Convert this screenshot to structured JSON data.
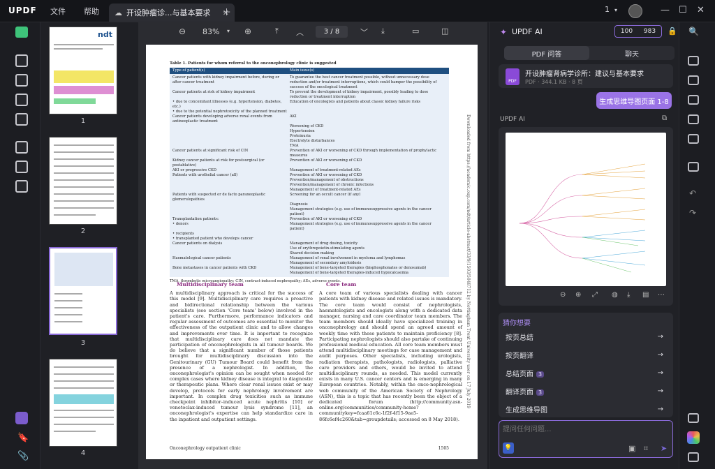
{
  "app": {
    "logo": "UPDF",
    "menu": [
      "文件",
      "帮助"
    ],
    "tab_title": "开设肿瘤诊...与基本要求",
    "page_count_badge": "1"
  },
  "toolbar": {
    "zoom": "83%",
    "page_indicator": "3 / 8"
  },
  "thumbnails": [
    {
      "label": "1"
    },
    {
      "label": "2"
    },
    {
      "label": "3"
    },
    {
      "label": "4"
    }
  ],
  "document": {
    "table_caption": "Table 1. Patients for whom referral to the onconephrology clinic is suggested",
    "col_headers": [
      "Type of patient(s)",
      "Main issue(s)"
    ],
    "rows": [
      [
        "Cancer patients with kidney impairment before, during or after cancer treatment",
        "To guarantee the best cancer treatment possible, without unnecessary dose reduction and/or treatment interruptions, which could hamper the possibility of success of the oncological treatment"
      ],
      [
        "Cancer patients at risk of kidney impairment",
        "To prevent the development of kidney impairment, possibly leading to dose reduction or treatment interruption"
      ],
      [
        "• due to concomitant illnesses (e.g. hypertension, diabetes, etc.)",
        "Education of oncologists and patients about classic kidney failure risks"
      ],
      [
        "• due to the potential nephrotoxicity of the planned treatment",
        ""
      ],
      [
        "Cancer patients developing adverse renal events from antineoplastic treatment",
        "AKI"
      ],
      [
        "",
        "Worsening of CKD"
      ],
      [
        "",
        "Hypertension"
      ],
      [
        "",
        "Proteinuria"
      ],
      [
        "",
        "Electrolyte disturbances"
      ],
      [
        "",
        "TMA"
      ],
      [
        "Cancer patients at significant risk of CIN",
        "Prevention of AKI or worsening of CKD through implementation of prophylactic measures"
      ],
      [
        "Kidney cancer patients at risk for postsurgical (or postablative)",
        "Prevention of AKI or worsening of CKD"
      ],
      [
        "AKI or progressive CKD",
        "Management of treatment-related AEs"
      ],
      [
        "Patients with urothelial cancer (all)",
        "Prevention of AKI or worsening of CKD"
      ],
      [
        "",
        "Prevention/management of obstructions"
      ],
      [
        "",
        "Prevention/management of chronic infections"
      ],
      [
        "",
        "Management of treatment-related AEs"
      ],
      [
        "Patients with suspected or de facto paraneoplastic glomerulopathies",
        "Screening for an occult cancer (if any)"
      ],
      [
        "",
        "Diagnosis"
      ],
      [
        "",
        "Management strategies (e.g. use of immunosuppressive agents in the cancer patient)"
      ],
      [
        "Transplantation patients:",
        "Prevention of AKI or worsening of CKD"
      ],
      [
        "• donors",
        "Management strategies (e.g. use of immunosuppressive agents in the cancer patient)"
      ],
      [
        "• recipients",
        ""
      ],
      [
        "• transplanted patient who develops cancer",
        ""
      ],
      [
        "Cancer patients on dialysis",
        "Management of drug dosing, toxicity"
      ],
      [
        "",
        "Use of erythropoietin-stimulating agents"
      ],
      [
        "",
        "Shared decision making"
      ],
      [
        "Haematological cancer patients",
        "Management of renal involvement in myeloma and lymphomas"
      ],
      [
        "",
        "Management of secondary amyloidosis"
      ],
      [
        "Bone metastases in cancer patients with CKD",
        "Management of bone-targeted therapies (bisphosphonates or denosumab)"
      ],
      [
        "",
        "Management of bone-targeted therapies-induced hypocalcaemia"
      ]
    ],
    "table_note": "TMA, thrombotic microangiopathy; CIN, contrast-induced nephropathy; AEs, adverse events.",
    "left_heading": "Multidisciplinary team",
    "left_body": "A multidisciplinary approach is critical for the success of this model [9]. Multidisciplinary care requires a proactive and bidirectional relationship between the various specialists (see section 'Core team' below) involved in the patient's care. Furthermore, performance indicators and regular assessment of outcomes are essential to monitor the effectiveness of the outpatient clinic and to allow changes and improvements over time. It is important to recognize that multidisciplinary care does not mandate the participation of onconephrologists in all tumour boards. We do believe that a significant number of those patients brought for multidisciplinary discussion into the Genitourinary (GU) Tumour Board could benefit from the presence of a nephrologist. In addition, the onconephrologist's opinion can be sought when needed for complex cases where kidney disease is integral to diagnostic or therapeutic plans. Where clear renal issues exist or may develop, protocols for early nephrology involvement are important. In complex drug toxicities such as immune checkpoint inhibitor–induced acute nephritis [10] or venetoclax-induced tumour lysis syndrome [11], an onconephrologist's expertise can help standardize care in the inpatient and outpatient settings.",
    "right_heading": "Core team",
    "right_body": "A core team of various specialists dealing with cancer patients with kidney disease and related issues is mandatory. The core team would consist of nephrologists, haematologists and oncologists along with a dedicated data manager, nursing and care coordinator team members. The team members should ideally have specialized training in onconephrology and should spend an agreed amount of weekly time with these patients to maintain proficiency [8]. Participating nephrologists should also partake of continuing professional medical education. All core team members must attend multidisciplinary meetings for case management and audit purposes. Other specialists, including urologists, radiation therapists, pathologists, radiologists, palliative care providers and others, would be invited to attend multidisciplinary rounds, as needed. This model currently exists in many U.S. cancer centers and is emerging in many European countries. Notably, within the onco-nephrological web community of the American Society of Nephrology (ASN), this is a topic that has recently been the object of a dedicated forum (http://community.asn-online.org/communities/community-home?communitykey=fcaa61c6c-1f2f-4f15-9ae5-86fc6ef4c260&tab=groupdetails; accessed on 8 May 2018).",
    "side_note": "Downloaded from https://academic.oup.com/ndt/article-abstract/33/9/1503/5048712 by Nottingham Trent University user on 17 July 2019",
    "footer_left": "Onconephrology outpatient clinic",
    "footer_right": "1505"
  },
  "ai_panel": {
    "title": "UPDF AI",
    "credits_a": "100",
    "credits_b": "983",
    "tabs": [
      "PDF 问答",
      "聊天"
    ],
    "doc_title": "开设肿瘤肾病学诊所：建议与基本要求",
    "doc_meta": "PDF · 344.1 KB · 8 页",
    "gen_button": "生成思维导图页面 1-8",
    "section_label": "UPDF AI",
    "suggest_title": "猜你想要",
    "suggestions": [
      {
        "label": "按页总结",
        "badge": ""
      },
      {
        "label": "按页翻译",
        "badge": ""
      },
      {
        "label": "总结页面",
        "badge": "3"
      },
      {
        "label": "翻译页面",
        "badge": "3"
      },
      {
        "label": "生成思维导图",
        "badge": ""
      }
    ],
    "input_placeholder": "提问任何问题..."
  },
  "colors": {
    "accent": "#9a73e6",
    "table_head": "#1f4f80",
    "heading": "#8a2a7e"
  }
}
